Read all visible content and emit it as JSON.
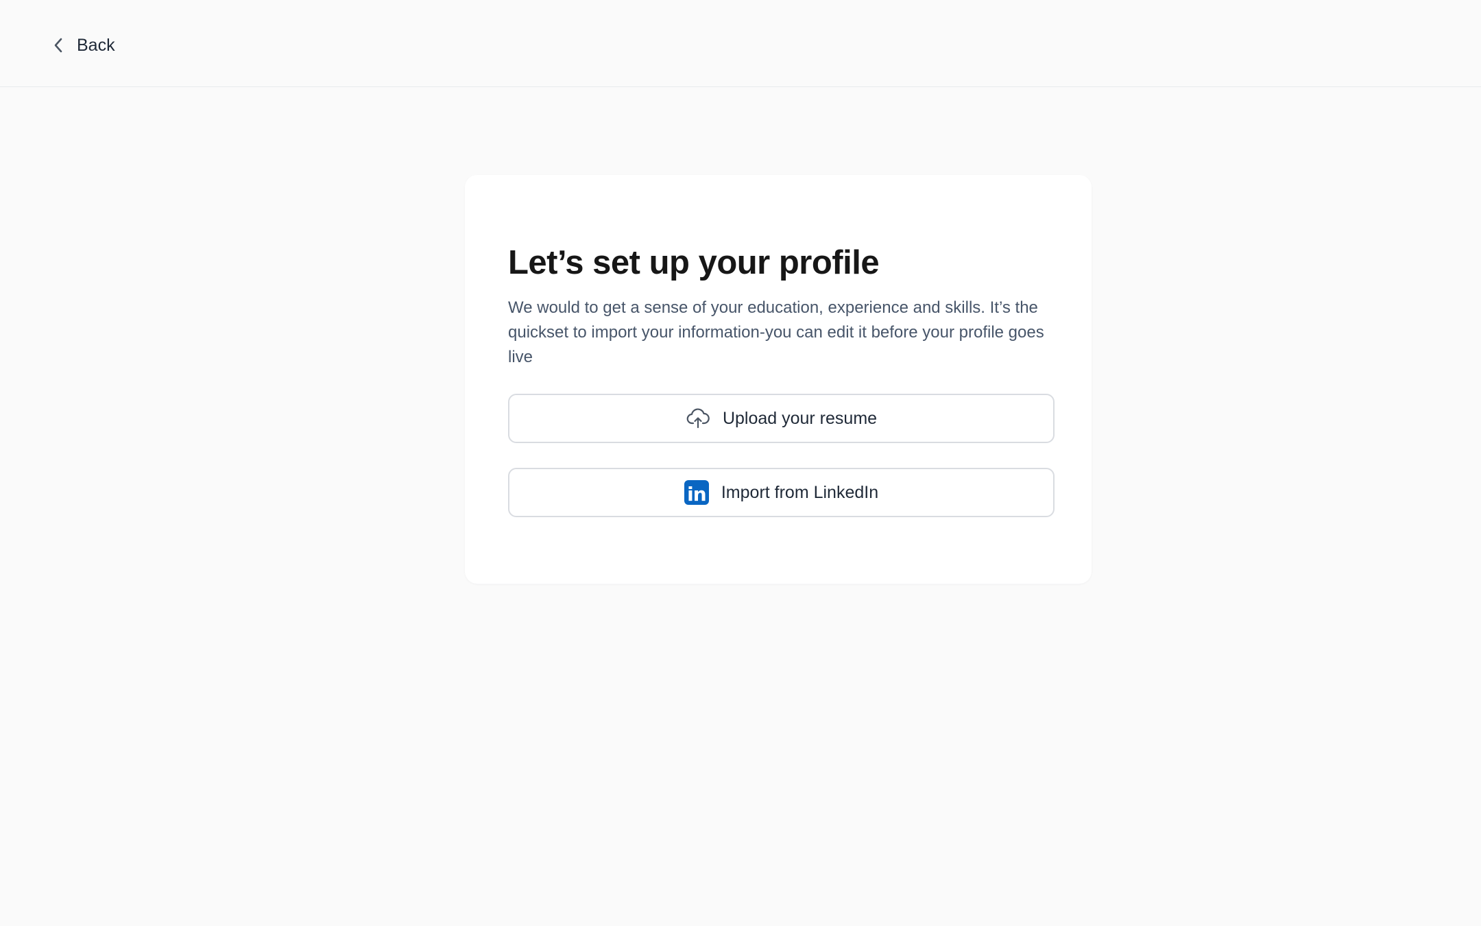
{
  "header": {
    "back_label": "Back",
    "back_icon": "chevron-left-icon"
  },
  "card": {
    "title": "Let’s set up your profile",
    "description": "We would to get a sense of your education, experience and skills. It’s the quickset to import your information-you can edit it before your profile goes live",
    "upload_button": {
      "label": "Upload your resume",
      "icon": "cloud-upload-icon"
    },
    "linkedin_button": {
      "label": "Import from LinkedIn",
      "icon": "linkedin-icon",
      "logo_text": "in",
      "brand_color": "#0a66c2"
    }
  },
  "colors": {
    "page_background": "#fafafa",
    "card_background": "#ffffff",
    "title_text": "#171717",
    "body_text": "#475569",
    "button_border": "#d9dce1"
  }
}
